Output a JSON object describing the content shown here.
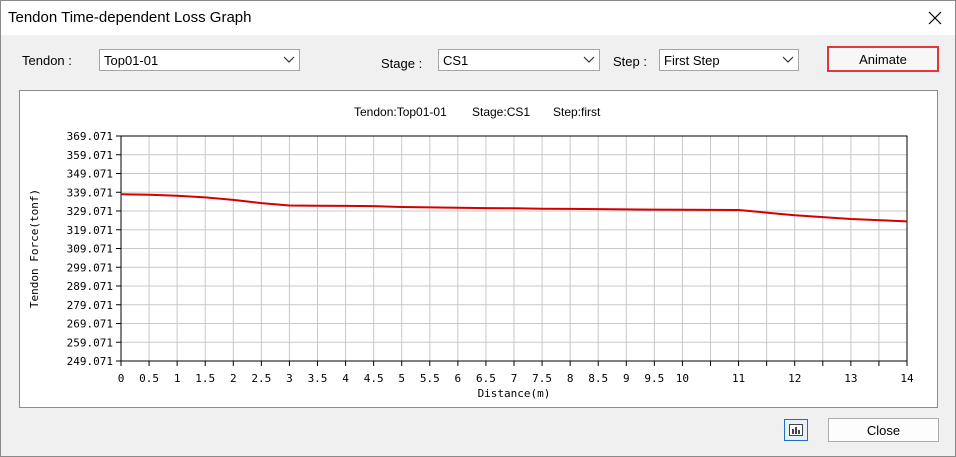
{
  "window": {
    "title": "Tendon Time-dependent Loss Graph"
  },
  "controls": {
    "tendon_label": "Tendon :",
    "tendon_value": "Top01-01",
    "stage_label": "Stage :",
    "stage_value": "CS1",
    "step_label": "Step :",
    "step_value": "First Step",
    "animate_label": "Animate"
  },
  "footer": {
    "close_label": "Close",
    "chart_icon": "chart-icon"
  },
  "chart_data": {
    "type": "line",
    "title_parts": [
      "Tendon:Top01-01",
      "Stage:CS1",
      "Step:first"
    ],
    "xlabel": "Distance(m)",
    "ylabel": "Tendon Force(tonf)",
    "xlim": [
      0,
      14
    ],
    "ylim": [
      249.071,
      369.071
    ],
    "x_ticks": [
      "0",
      "0.5",
      "1",
      "1.5",
      "2",
      "2.5",
      "3",
      "3.5",
      "4",
      "4.5",
      "5",
      "5.5",
      "6",
      "6.5",
      "7",
      "7.5",
      "8",
      "8.5",
      "9",
      "9.5",
      "10",
      "11",
      "12",
      "13",
      "14"
    ],
    "x_tick_values": [
      0,
      0.5,
      1,
      1.5,
      2,
      2.5,
      3,
      3.5,
      4,
      4.5,
      5,
      5.5,
      6,
      6.5,
      7,
      7.5,
      8,
      8.5,
      9,
      9.5,
      10,
      11,
      12,
      13,
      14
    ],
    "y_ticks": [
      "369.071",
      "359.071",
      "349.071",
      "339.071",
      "329.071",
      "319.071",
      "309.071",
      "299.071",
      "289.071",
      "279.071",
      "269.071",
      "259.071",
      "249.071"
    ],
    "grid": true,
    "series": [
      {
        "color": "#d40000",
        "x": [
          0,
          0.5,
          1,
          1.5,
          2,
          2.5,
          3,
          3.5,
          4,
          4.5,
          5,
          5.5,
          6,
          6.5,
          7,
          7.5,
          8,
          8.5,
          9,
          9.5,
          10,
          11,
          12,
          13,
          14
        ],
        "y": [
          338.0,
          337.7,
          337.2,
          336.3,
          335.0,
          333.3,
          332.0,
          331.9,
          331.8,
          331.7,
          331.2,
          331.0,
          330.8,
          330.6,
          330.5,
          330.3,
          330.2,
          330.1,
          329.9,
          329.8,
          329.7,
          329.6,
          326.8,
          324.8,
          323.5
        ]
      }
    ]
  }
}
